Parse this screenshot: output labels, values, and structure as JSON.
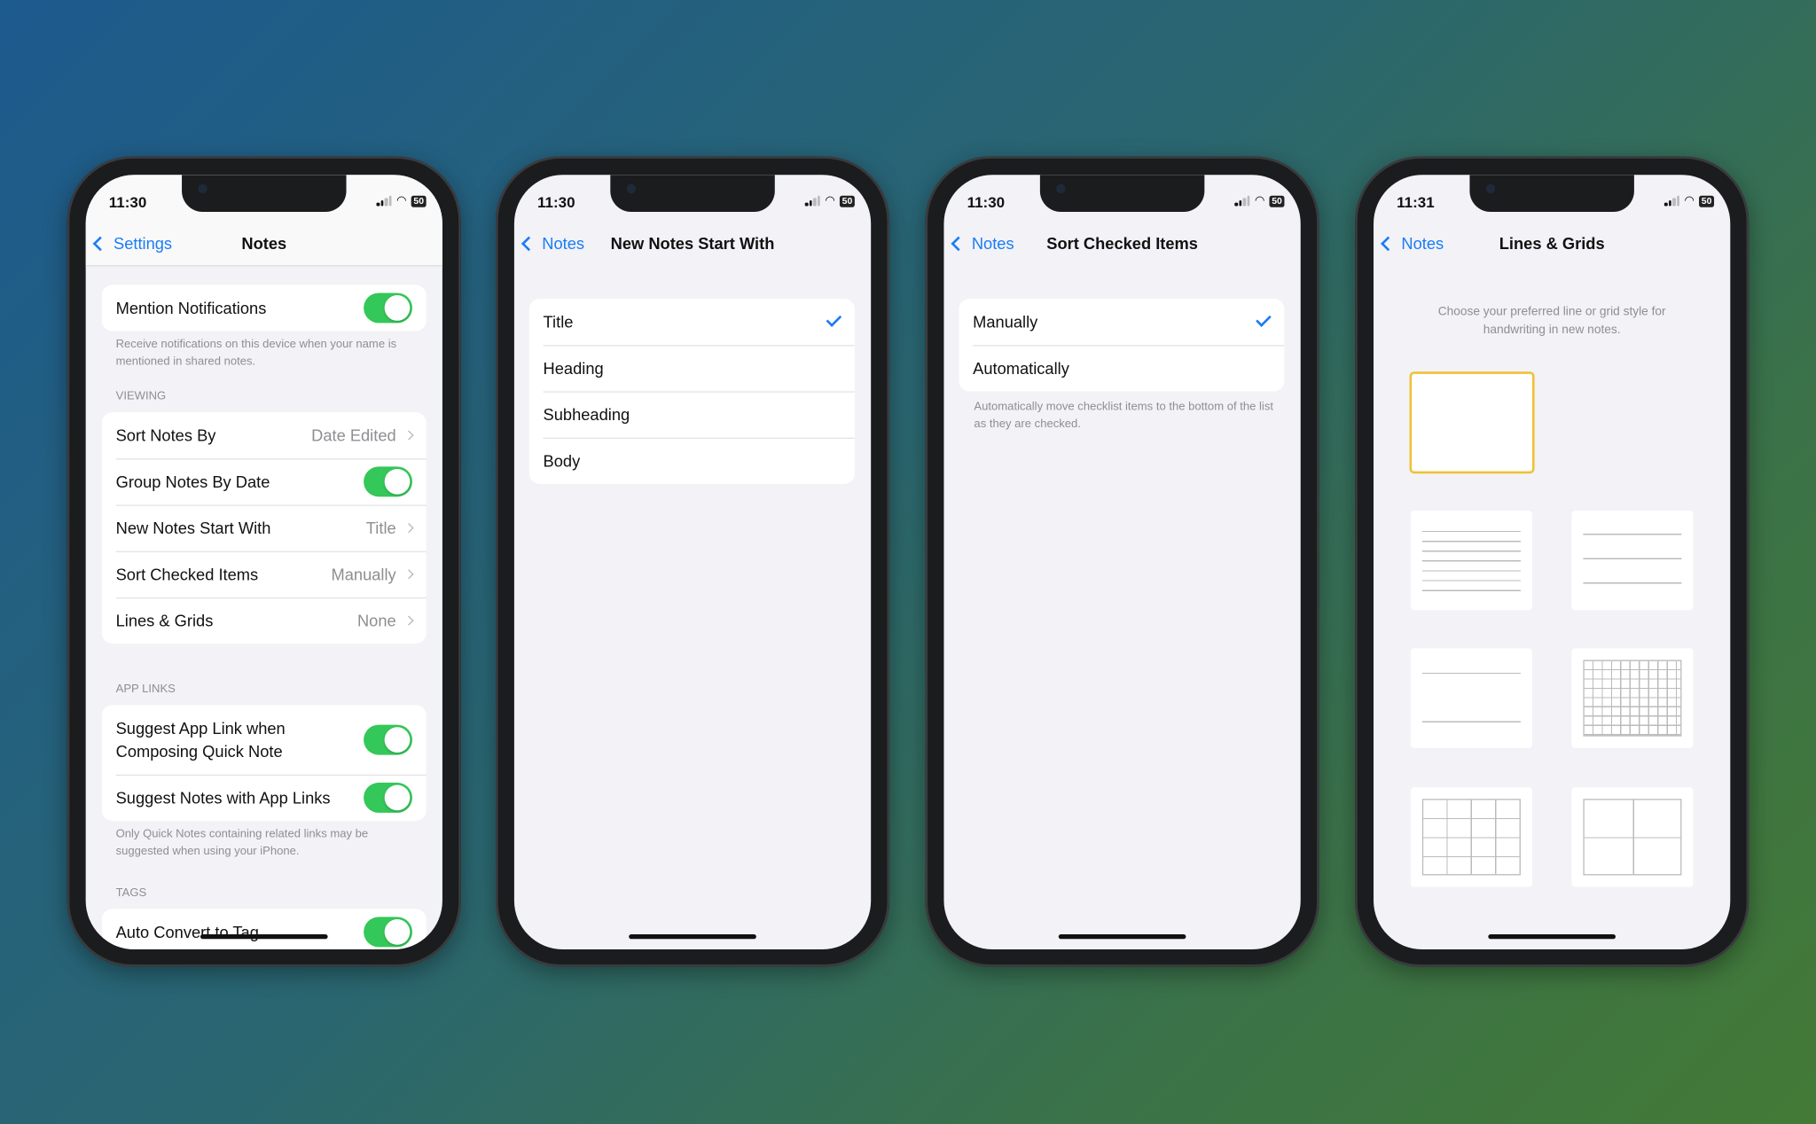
{
  "colors": {
    "accent": "#1a7cf5",
    "toggle_on": "#34c759",
    "selected_tile": "#efc236"
  },
  "status_icons": [
    "signal-icon",
    "wifi-icon",
    "battery-icon"
  ],
  "battery": "50",
  "phone1": {
    "time": "11:30",
    "back": "Settings",
    "title": "Notes",
    "mention": {
      "label": "Mention Notifications",
      "on": true
    },
    "mention_footer": "Receive notifications on this device when your name is mentioned in shared notes.",
    "viewing_header": "VIEWING",
    "viewing": [
      {
        "label": "Sort Notes By",
        "value": "Date Edited"
      },
      {
        "label": "Group Notes By Date",
        "on": true
      },
      {
        "label": "New Notes Start With",
        "value": "Title"
      },
      {
        "label": "Sort Checked Items",
        "value": "Manually"
      },
      {
        "label": "Lines & Grids",
        "value": "None"
      }
    ],
    "applinks_header": "APP LINKS",
    "applinks": [
      {
        "label": "Suggest App Link when Composing Quick Note",
        "on": true
      },
      {
        "label": "Suggest Notes with App Links",
        "on": true
      }
    ],
    "applinks_footer": "Only Quick Notes containing related links may be suggested when using your iPhone.",
    "tags_header": "TAGS",
    "tags": [
      {
        "label": "Auto Convert to Tag",
        "on": true
      }
    ]
  },
  "phone2": {
    "time": "11:30",
    "back": "Notes",
    "title": "New Notes Start With",
    "options": [
      "Title",
      "Heading",
      "Subheading",
      "Body"
    ],
    "selected": "Title"
  },
  "phone3": {
    "time": "11:30",
    "back": "Notes",
    "title": "Sort Checked Items",
    "options": [
      "Manually",
      "Automatically"
    ],
    "selected": "Manually",
    "footer": "Automatically move checklist items to the bottom of the list as they are checked."
  },
  "phone4": {
    "time": "11:31",
    "back": "Notes",
    "title": "Lines & Grids",
    "description": "Choose your preferred line or grid style for handwriting in new notes.",
    "styles": [
      "none",
      "narrow-lines",
      "medium-lines",
      "wide-lines",
      "small-grid",
      "medium-grid",
      "large-grid"
    ],
    "selected": "none"
  }
}
